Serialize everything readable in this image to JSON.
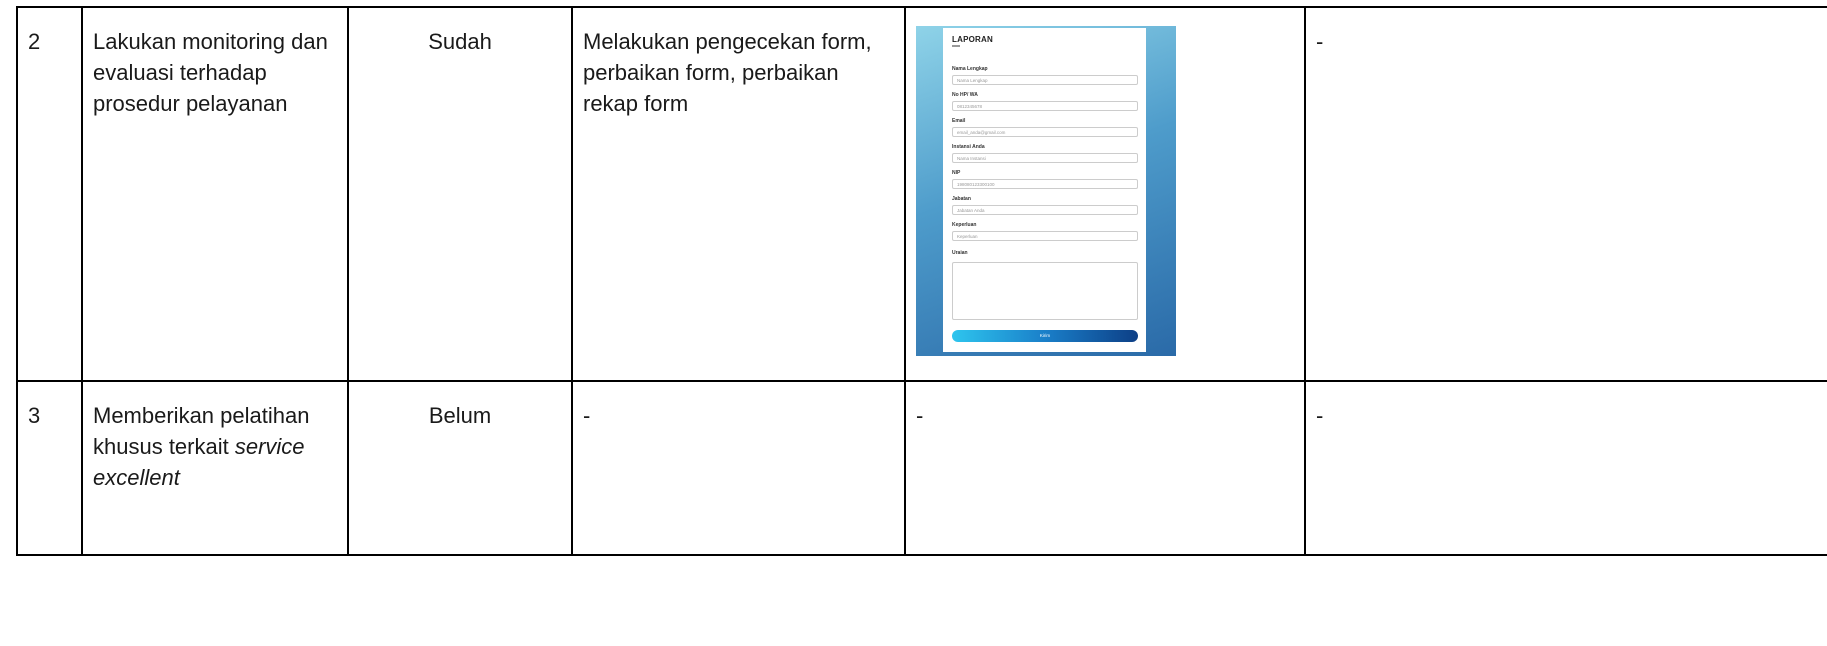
{
  "rows": [
    {
      "no": "2",
      "activity": "Lakukan monitoring dan evaluasi terhadap prosedur pelayanan",
      "status": "Sudah",
      "description": "Melakukan pengecekan form, perbaikan form, perbaikan rekap form",
      "evidence": "",
      "notes": "-"
    },
    {
      "no": "3",
      "activity_plain": "Memberikan pelatihan khusus terkait ",
      "activity_italic": "service excellent",
      "status": "Belum",
      "description": "-",
      "evidence": "-",
      "notes": "-"
    }
  ],
  "form": {
    "title": "LAPORAN",
    "fields": [
      {
        "label": "Nama Lengkap",
        "placeholder": "Nama Lengkap"
      },
      {
        "label": "No HP/ WA",
        "placeholder": "0812345678"
      },
      {
        "label": "Email",
        "placeholder": "email_anda@gmail.com"
      },
      {
        "label": "Instansi Anda",
        "placeholder": "Nama Instansi"
      },
      {
        "label": "NIP",
        "placeholder": "198080123300100"
      },
      {
        "label": "Jabatan",
        "placeholder": "Jabatan Anda"
      },
      {
        "label": "Keperluan",
        "placeholder": "Keperluan"
      }
    ],
    "textarea_label": "Uraian",
    "submit_label": "Kirim"
  }
}
